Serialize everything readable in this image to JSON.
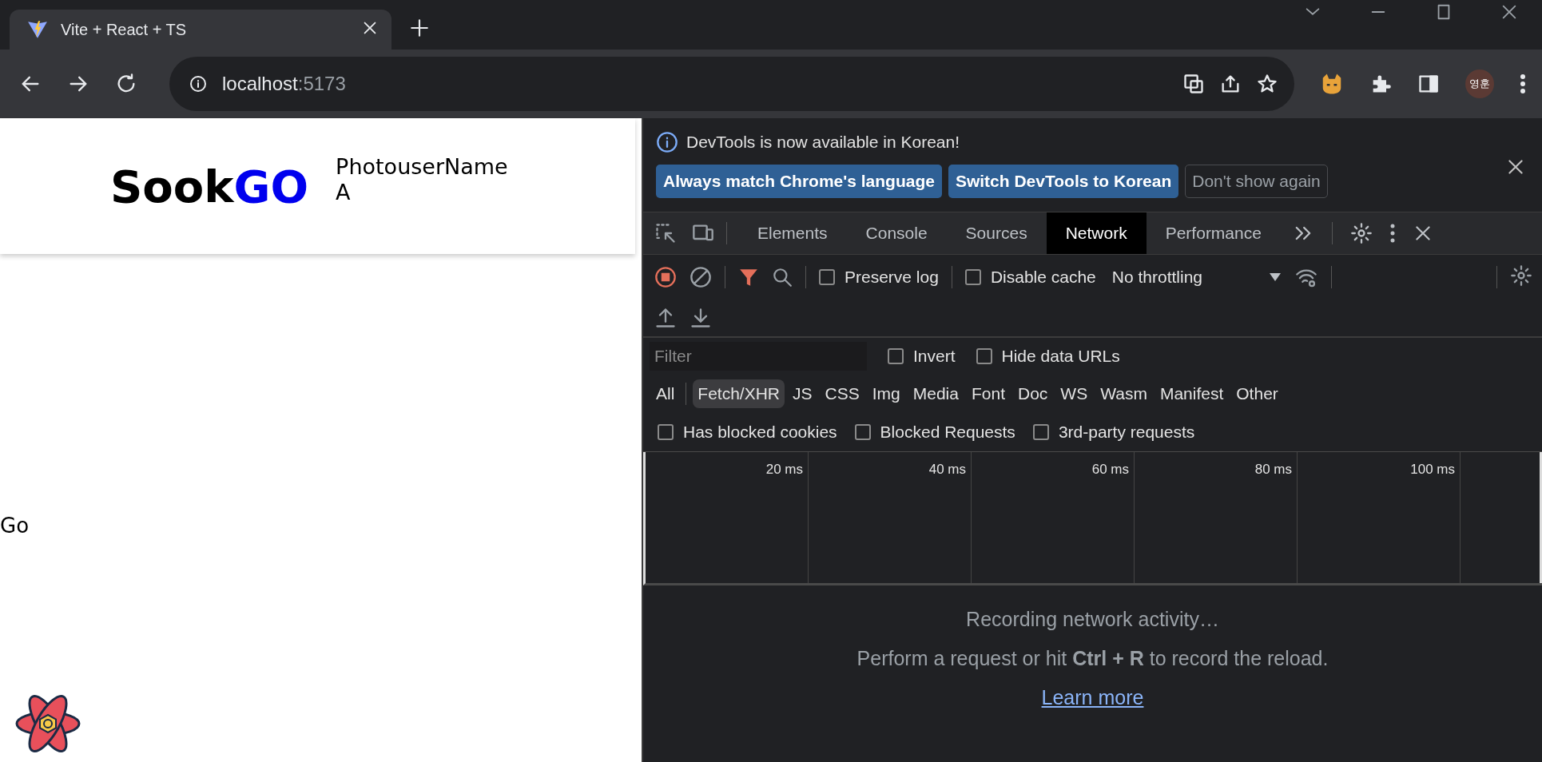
{
  "browser": {
    "tab": {
      "title": "Vite + React + TS"
    },
    "address": {
      "host": "localhost",
      "port": ":5173"
    },
    "profile": "영훈"
  },
  "page": {
    "logo": {
      "first": "Sook",
      "second": "GO"
    },
    "user_lines": [
      "PhotouserName",
      "A"
    ],
    "body_text": "Go"
  },
  "devtools": {
    "infobar": {
      "message": "DevTools is now available in Korean!",
      "buttons": [
        {
          "label": "Always match Chrome's language",
          "kind": "primary"
        },
        {
          "label": "Switch DevTools to Korean",
          "kind": "primary"
        },
        {
          "label": "Don't show again",
          "kind": "outline"
        }
      ]
    },
    "tabs": [
      {
        "label": "Elements",
        "selected": false
      },
      {
        "label": "Console",
        "selected": false
      },
      {
        "label": "Sources",
        "selected": false
      },
      {
        "label": "Network",
        "selected": true
      },
      {
        "label": "Performance",
        "selected": false
      }
    ],
    "toolbar": {
      "recording": true,
      "options": [
        {
          "label": "Preserve log",
          "checked": false
        },
        {
          "label": "Disable cache",
          "checked": false
        }
      ],
      "throttling": "No throttling"
    },
    "filter": {
      "placeholder": "Filter",
      "options": [
        {
          "label": "Invert",
          "checked": false
        },
        {
          "label": "Hide data URLs",
          "checked": false
        }
      ]
    },
    "types": [
      {
        "label": "All",
        "selected": false
      },
      {
        "label": "Fetch/XHR",
        "selected": true
      },
      {
        "label": "JS",
        "selected": false
      },
      {
        "label": "CSS",
        "selected": false
      },
      {
        "label": "Img",
        "selected": false
      },
      {
        "label": "Media",
        "selected": false
      },
      {
        "label": "Font",
        "selected": false
      },
      {
        "label": "Doc",
        "selected": false
      },
      {
        "label": "WS",
        "selected": false
      },
      {
        "label": "Wasm",
        "selected": false
      },
      {
        "label": "Manifest",
        "selected": false
      },
      {
        "label": "Other",
        "selected": false
      }
    ],
    "extra_filters": [
      {
        "label": "Has blocked cookies",
        "checked": false
      },
      {
        "label": "Blocked Requests",
        "checked": false
      },
      {
        "label": "3rd-party requests",
        "checked": false
      }
    ],
    "timeline": {
      "ticks": [
        "20 ms",
        "40 ms",
        "60 ms",
        "80 ms",
        "100 ms"
      ]
    },
    "empty": {
      "title": "Recording network activity…",
      "hint": "Perform a request or hit **Ctrl + R** to record the reload.",
      "link": "Learn more"
    }
  }
}
